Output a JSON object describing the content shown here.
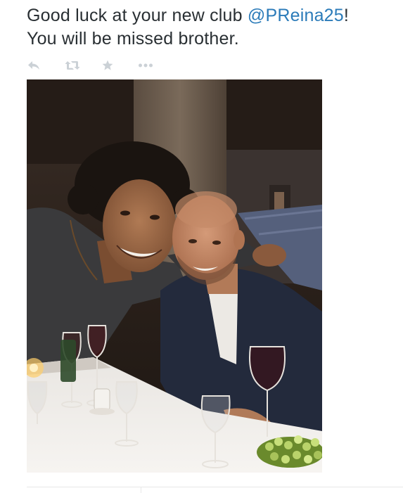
{
  "tweet": {
    "text_line1_prefix": "Good luck at your new club ",
    "mention": "@PReina25",
    "text_line1_suffix": "!",
    "text_line2": "You will be missed brother."
  },
  "actions": [
    {
      "name": "reply",
      "icon": "reply-icon"
    },
    {
      "name": "retweet",
      "icon": "retweet-icon"
    },
    {
      "name": "favorite",
      "icon": "star-icon"
    },
    {
      "name": "more",
      "icon": "more-dots-icon"
    }
  ],
  "colors": {
    "text": "#292f33",
    "link": "#2b7bb9",
    "action_icon": "#cbd1d6",
    "divider": "#e8e8e8"
  },
  "photo": {
    "description_icon": "photo-image"
  }
}
